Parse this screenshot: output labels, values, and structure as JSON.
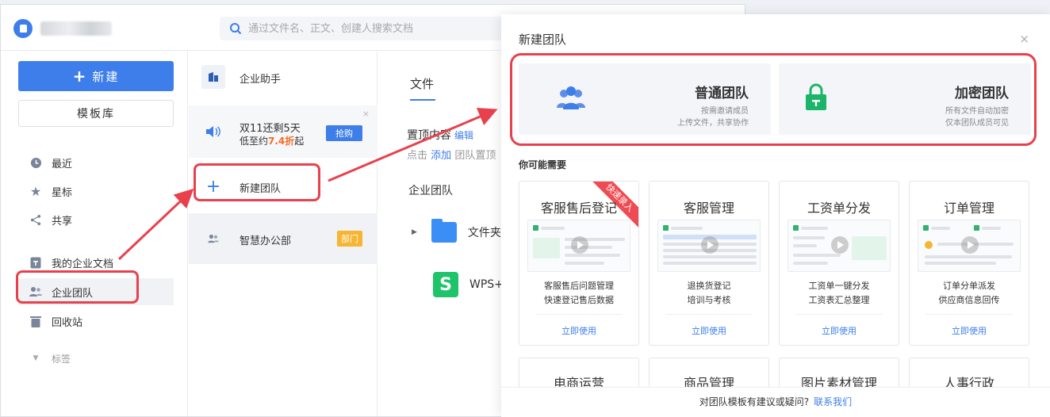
{
  "header": {
    "search_placeholder": "通过文件名、正文、创建人搜索文档"
  },
  "sidebar": {
    "new_button": "新建",
    "template_button": "模板库",
    "nav": [
      {
        "label": "最近",
        "icon": "clock-icon"
      },
      {
        "label": "星标",
        "icon": "star-icon"
      },
      {
        "label": "共享",
        "icon": "share-icon"
      },
      {
        "label": "我的企业文档",
        "icon": "document-icon"
      },
      {
        "label": "企业团队",
        "icon": "team-icon"
      },
      {
        "label": "回收站",
        "icon": "trash-icon"
      }
    ],
    "tags_label": "标签"
  },
  "middle": {
    "assistant": "企业助手",
    "promo_line1": "双11还剩5天",
    "promo_line2_prefix": "低至约",
    "promo_line2_highlight": "7.4折",
    "promo_line2_suffix": "起",
    "promo_button": "抢购",
    "new_team": "新建团队",
    "dept_team": "智慧办公部",
    "dept_badge": "部门"
  },
  "content": {
    "tab_files": "文件",
    "pinned_title": "置顶内容",
    "pinned_edit": "编辑",
    "pinned_hint_prefix": "点击",
    "pinned_hint_link": "添加",
    "pinned_hint_suffix": "团队置顶",
    "enterprise_team": "企业团队",
    "folder_name": "文件夹(",
    "wps_name": "WPS+"
  },
  "modal": {
    "title": "新建团队",
    "close": "×",
    "normal_team": {
      "title": "普通团队",
      "desc1": "按需邀请成员",
      "desc2": "上传文件，共享协作"
    },
    "secure_team": {
      "title": "加密团队",
      "desc1": "所有文件自动加密",
      "desc2": "仅本团队成员可见"
    },
    "need_label": "你可能需要",
    "templates": [
      {
        "name": "客服售后登记",
        "desc1": "客服售后问题管理",
        "desc2": "快速登记售后数据",
        "use": "立即使用",
        "ribbon": "快速录入"
      },
      {
        "name": "客服管理",
        "desc1": "退换货登记",
        "desc2": "培训与考核",
        "use": "立即使用"
      },
      {
        "name": "工资单分发",
        "desc1": "工资单一键分发",
        "desc2": "工资表汇总整理",
        "use": "立即使用"
      },
      {
        "name": "订单管理",
        "desc1": "订单分单派发",
        "desc2": "供应商信息回传",
        "use": "立即使用"
      }
    ],
    "templates_row2": [
      "电商运营",
      "商品管理",
      "图片素材管理",
      "人事行政"
    ],
    "footer_text": "对团队模板有建议或疑问?",
    "footer_link": "联系我们"
  },
  "colors": {
    "accent": "#3d7eea",
    "annotation": "#e8414d",
    "secure_green": "#1bb56a"
  }
}
